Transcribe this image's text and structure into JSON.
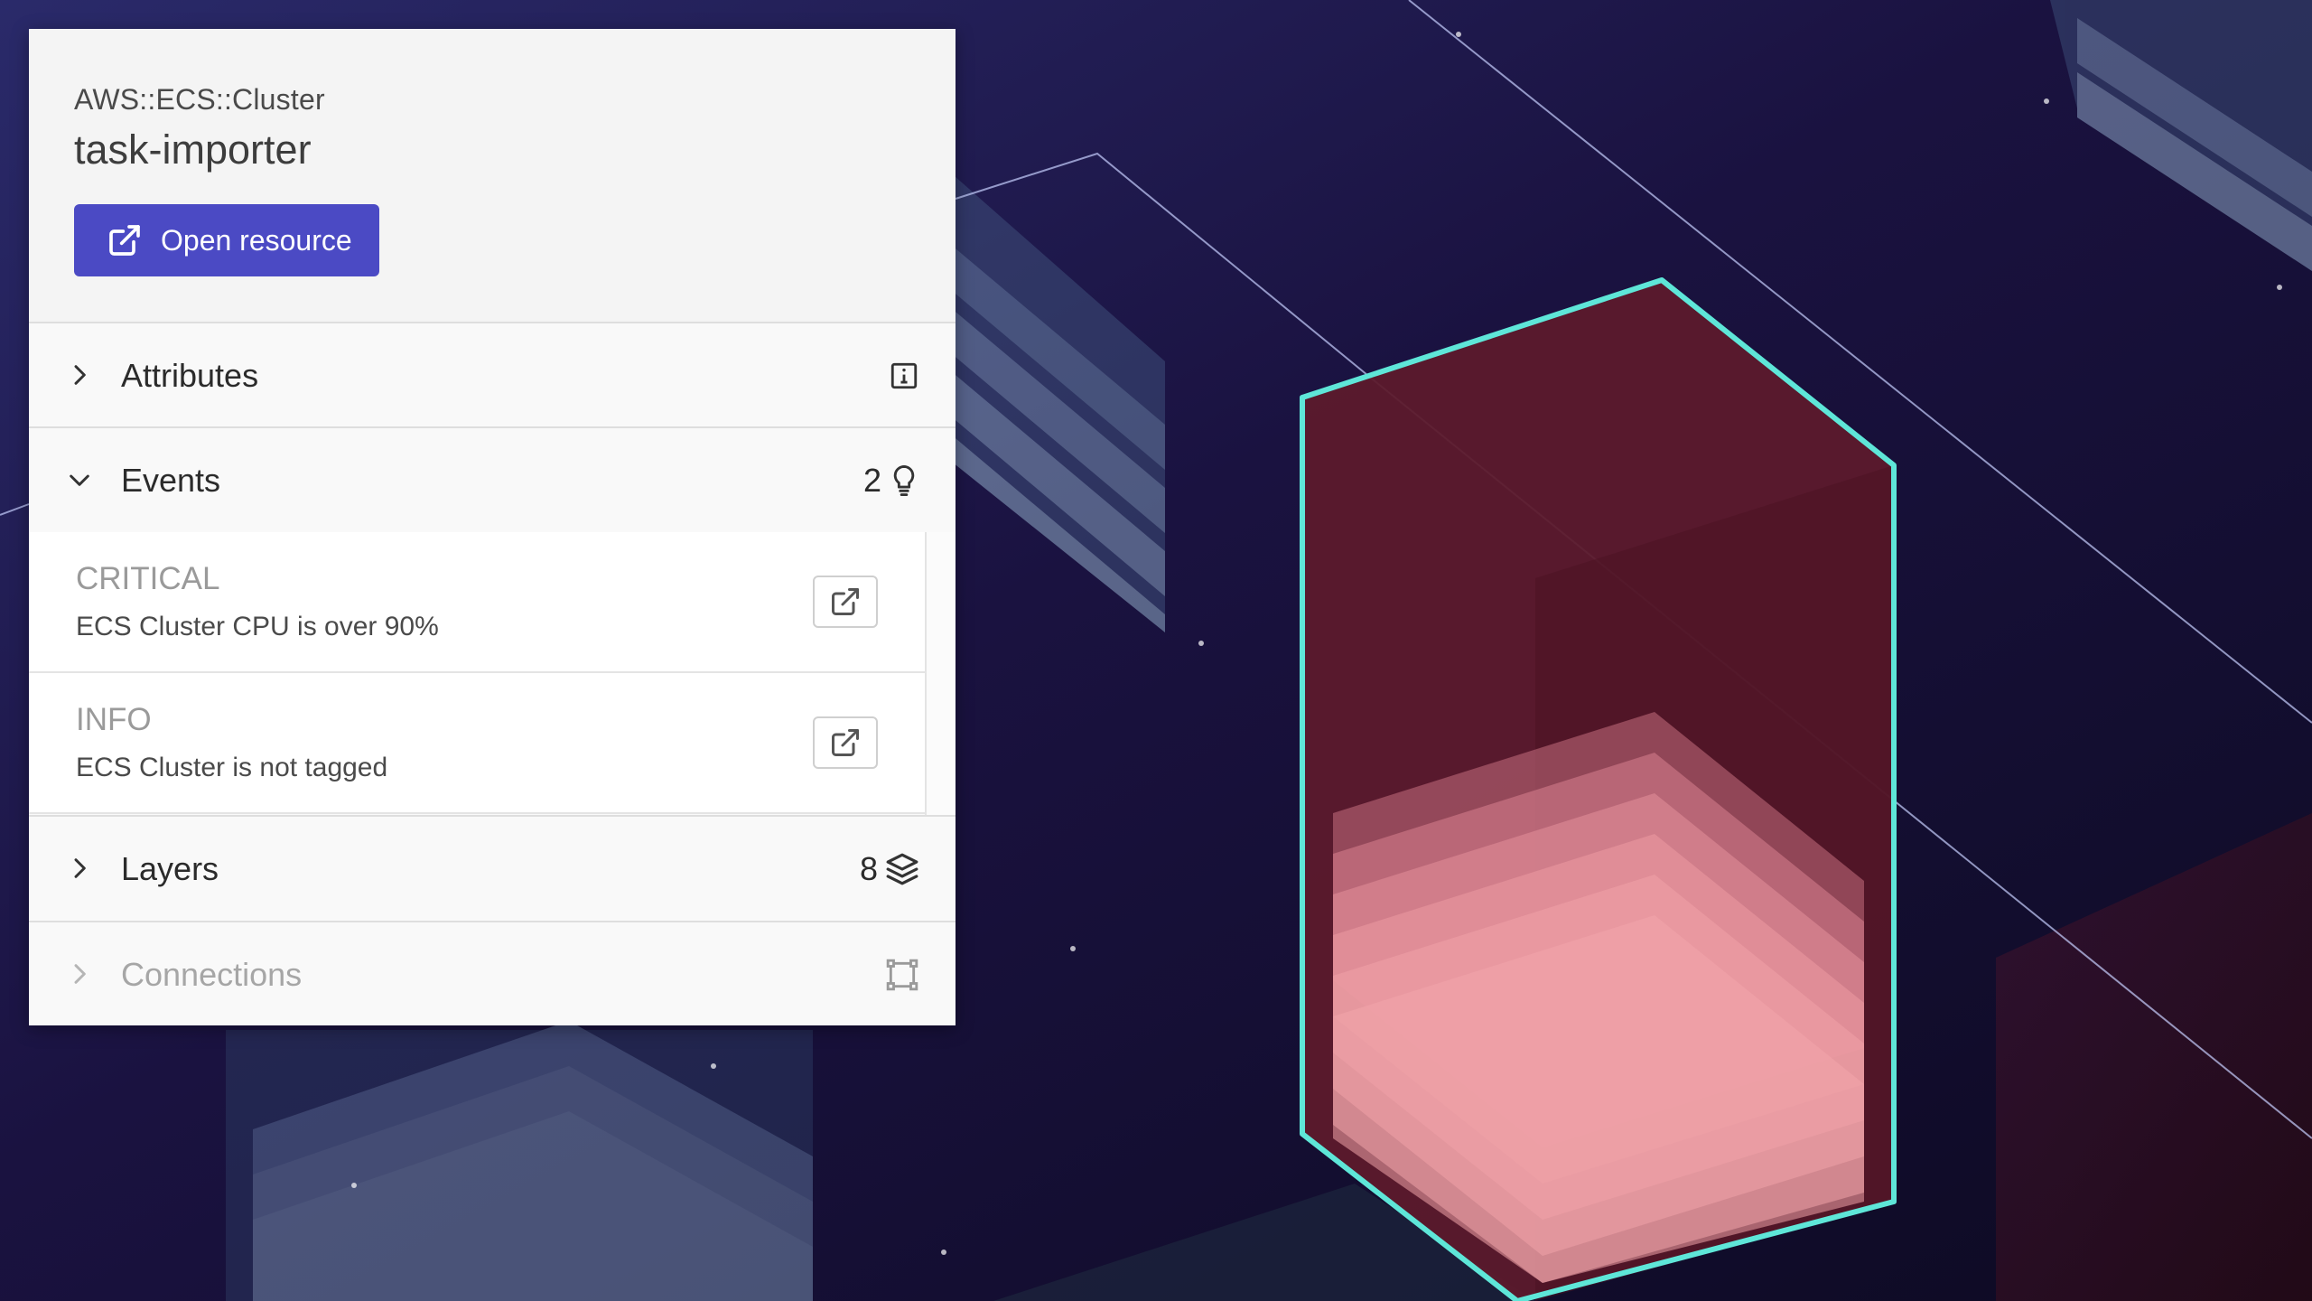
{
  "panel": {
    "resource_type": "AWS::ECS::Cluster",
    "resource_name": "task-importer",
    "open_button_label": "Open resource",
    "sections": {
      "attributes": {
        "label": "Attributes",
        "icon": "info-icon"
      },
      "events": {
        "label": "Events",
        "count": "2",
        "icon": "lightbulb-icon",
        "expanded": true
      },
      "layers": {
        "label": "Layers",
        "count": "8",
        "icon": "layers-icon"
      },
      "connections": {
        "label": "Connections",
        "icon": "connections-icon",
        "disabled": true
      }
    },
    "events": [
      {
        "severity": "CRITICAL",
        "message": "ECS Cluster CPU is over 90%"
      },
      {
        "severity": "INFO",
        "message": "ECS Cluster is not tagged"
      }
    ]
  },
  "colors": {
    "background": "#140f33",
    "button": "#4b4ac4",
    "highlight_outline": "#5ee6d8",
    "highlight_fill": "#5c1a2c",
    "layer_fill": "#f0a0a4"
  }
}
